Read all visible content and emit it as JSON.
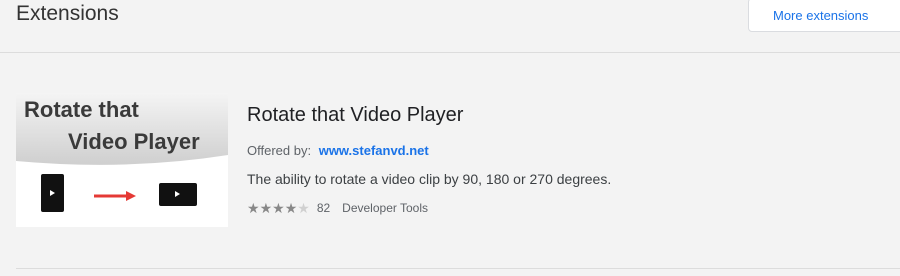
{
  "page": {
    "title": "Extensions",
    "more_extensions_label": "More extensions"
  },
  "extension": {
    "name": "Rotate that Video Player",
    "offered_by_label": "Offered by:",
    "offered_by_link": "www.stefanvd.net",
    "description": "The ability to rotate a video clip by 90, 180 or 270 degrees.",
    "rating": 4,
    "rating_max": 5,
    "rating_count": "82",
    "category": "Developer Tools",
    "thumbnail": {
      "line1": "Rotate that",
      "line2": "Video Player",
      "arrow_color": "#e53935",
      "icons": [
        "portrait-player-icon",
        "arrow-right-icon",
        "landscape-player-icon"
      ]
    }
  }
}
